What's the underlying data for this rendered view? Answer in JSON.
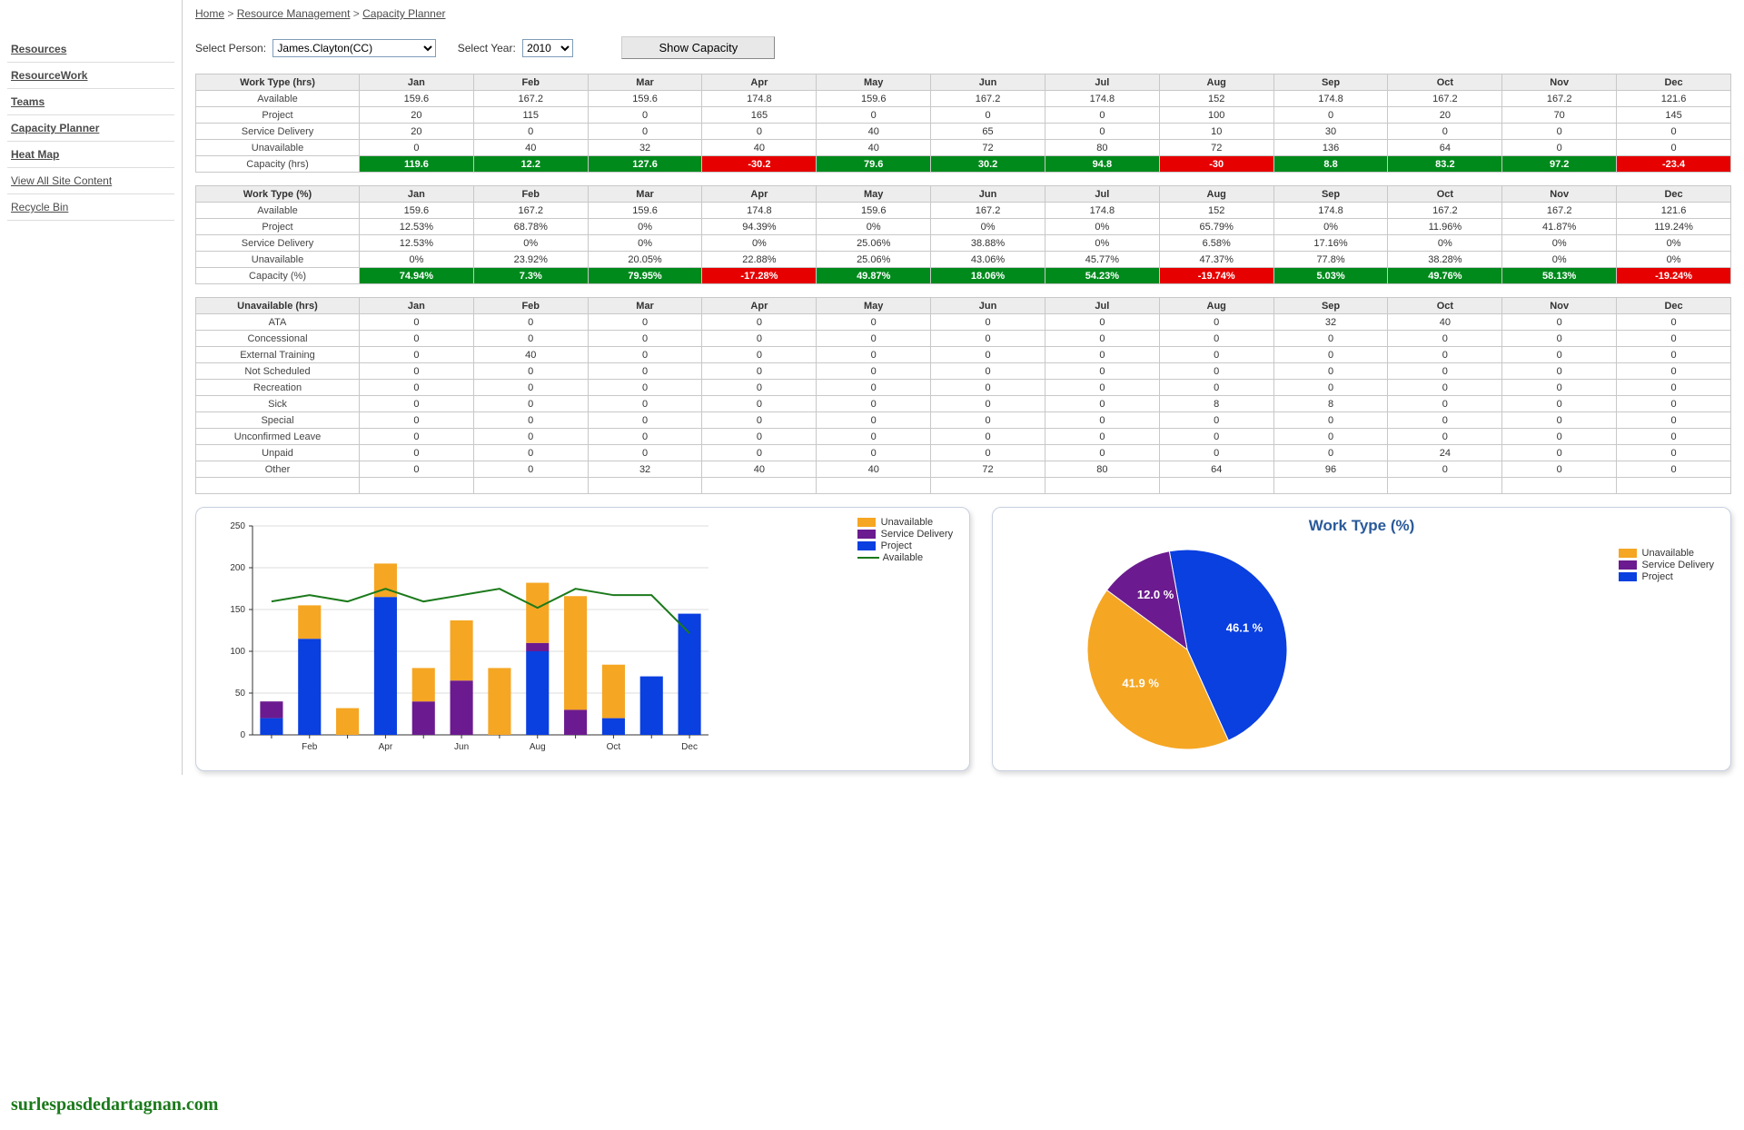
{
  "breadcrumb": {
    "home": "Home",
    "rm": "Resource Management",
    "cp": "Capacity Planner",
    "sep": " > "
  },
  "sidebar": {
    "items": [
      {
        "label": "Resources",
        "bold": true
      },
      {
        "label": "ResourceWork",
        "bold": true
      },
      {
        "label": "Teams",
        "bold": true
      },
      {
        "label": "Capacity Planner",
        "bold": true
      },
      {
        "label": "Heat Map",
        "bold": true
      },
      {
        "label": "View All Site Content",
        "bold": false
      },
      {
        "label": " Recycle Bin",
        "bold": false
      }
    ]
  },
  "controls": {
    "personLabel": "Select Person:",
    "personValue": "James.Clayton(CC)",
    "yearLabel": "Select Year:",
    "yearValue": "2010",
    "button": "Show Capacity"
  },
  "months": [
    "Jan",
    "Feb",
    "Mar",
    "Apr",
    "May",
    "Jun",
    "Jul",
    "Aug",
    "Sep",
    "Oct",
    "Nov",
    "Dec"
  ],
  "table1": {
    "header": "Work Type (hrs)",
    "rows": [
      {
        "label": "Available",
        "vals": [
          "159.6",
          "167.2",
          "159.6",
          "174.8",
          "159.6",
          "167.2",
          "174.8",
          "152",
          "174.8",
          "167.2",
          "167.2",
          "121.6"
        ]
      },
      {
        "label": "Project",
        "vals": [
          "20",
          "115",
          "0",
          "165",
          "0",
          "0",
          "0",
          "100",
          "0",
          "20",
          "70",
          "145"
        ]
      },
      {
        "label": "Service Delivery",
        "vals": [
          "20",
          "0",
          "0",
          "0",
          "40",
          "65",
          "0",
          "10",
          "30",
          "0",
          "0",
          "0"
        ]
      },
      {
        "label": "Unavailable",
        "vals": [
          "0",
          "40",
          "32",
          "40",
          "40",
          "72",
          "80",
          "72",
          "136",
          "64",
          "0",
          "0"
        ]
      },
      {
        "label": "Capacity (hrs)",
        "vals": [
          "119.6",
          "12.2",
          "127.6",
          "-30.2",
          "79.6",
          "30.2",
          "94.8",
          "-30",
          "8.8",
          "83.2",
          "97.2",
          "-23.4"
        ],
        "cls": [
          "green",
          "green",
          "green",
          "red",
          "green",
          "green",
          "green",
          "red",
          "green",
          "green",
          "green",
          "red"
        ]
      }
    ]
  },
  "table2": {
    "header": "Work Type (%)",
    "rows": [
      {
        "label": "Available",
        "vals": [
          "159.6",
          "167.2",
          "159.6",
          "174.8",
          "159.6",
          "167.2",
          "174.8",
          "152",
          "174.8",
          "167.2",
          "167.2",
          "121.6"
        ]
      },
      {
        "label": "Project",
        "vals": [
          "12.53%",
          "68.78%",
          "0%",
          "94.39%",
          "0%",
          "0%",
          "0%",
          "65.79%",
          "0%",
          "11.96%",
          "41.87%",
          "119.24%"
        ]
      },
      {
        "label": "Service Delivery",
        "vals": [
          "12.53%",
          "0%",
          "0%",
          "0%",
          "25.06%",
          "38.88%",
          "0%",
          "6.58%",
          "17.16%",
          "0%",
          "0%",
          "0%"
        ]
      },
      {
        "label": "Unavailable",
        "vals": [
          "0%",
          "23.92%",
          "20.05%",
          "22.88%",
          "25.06%",
          "43.06%",
          "45.77%",
          "47.37%",
          "77.8%",
          "38.28%",
          "0%",
          "0%"
        ]
      },
      {
        "label": "Capacity (%)",
        "vals": [
          "74.94%",
          "7.3%",
          "79.95%",
          "-17.28%",
          "49.87%",
          "18.06%",
          "54.23%",
          "-19.74%",
          "5.03%",
          "49.76%",
          "58.13%",
          "-19.24%"
        ],
        "cls": [
          "green",
          "green",
          "green",
          "red",
          "green",
          "green",
          "green",
          "red",
          "green",
          "green",
          "green",
          "red"
        ]
      }
    ]
  },
  "table3": {
    "header": "Unavailable (hrs)",
    "rows": [
      {
        "label": "ATA",
        "vals": [
          "0",
          "0",
          "0",
          "0",
          "0",
          "0",
          "0",
          "0",
          "32",
          "40",
          "0",
          "0"
        ]
      },
      {
        "label": "Concessional",
        "vals": [
          "0",
          "0",
          "0",
          "0",
          "0",
          "0",
          "0",
          "0",
          "0",
          "0",
          "0",
          "0"
        ]
      },
      {
        "label": "External Training",
        "vals": [
          "0",
          "40",
          "0",
          "0",
          "0",
          "0",
          "0",
          "0",
          "0",
          "0",
          "0",
          "0"
        ]
      },
      {
        "label": "Not Scheduled",
        "vals": [
          "0",
          "0",
          "0",
          "0",
          "0",
          "0",
          "0",
          "0",
          "0",
          "0",
          "0",
          "0"
        ]
      },
      {
        "label": "Recreation",
        "vals": [
          "0",
          "0",
          "0",
          "0",
          "0",
          "0",
          "0",
          "0",
          "0",
          "0",
          "0",
          "0"
        ]
      },
      {
        "label": "Sick",
        "vals": [
          "0",
          "0",
          "0",
          "0",
          "0",
          "0",
          "0",
          "8",
          "8",
          "0",
          "0",
          "0"
        ]
      },
      {
        "label": "Special",
        "vals": [
          "0",
          "0",
          "0",
          "0",
          "0",
          "0",
          "0",
          "0",
          "0",
          "0",
          "0",
          "0"
        ]
      },
      {
        "label": "Unconfirmed Leave",
        "vals": [
          "0",
          "0",
          "0",
          "0",
          "0",
          "0",
          "0",
          "0",
          "0",
          "0",
          "0",
          "0"
        ]
      },
      {
        "label": "Unpaid",
        "vals": [
          "0",
          "0",
          "0",
          "0",
          "0",
          "0",
          "0",
          "0",
          "0",
          "24",
          "0",
          "0"
        ]
      },
      {
        "label": "Other",
        "vals": [
          "0",
          "0",
          "32",
          "40",
          "40",
          "72",
          "80",
          "64",
          "96",
          "0",
          "0",
          "0"
        ]
      }
    ],
    "blankRow": true
  },
  "colors": {
    "unavailable": "#f5a623",
    "service": "#6b1b8f",
    "project": "#0a3fe0",
    "available": "#1b7a1b"
  },
  "chart_data": [
    {
      "type": "bar",
      "title": "",
      "ylabel": "",
      "xlabel": "",
      "ylim": [
        0,
        250
      ],
      "yticks": [
        0,
        50,
        100,
        150,
        200,
        250
      ],
      "categories": [
        "Jan",
        "Feb",
        "Mar",
        "Apr",
        "May",
        "Jun",
        "Jul",
        "Aug",
        "Sep",
        "Oct",
        "Nov",
        "Dec"
      ],
      "xTickLabels": [
        "Feb",
        "Apr",
        "Jun",
        "Aug",
        "Oct",
        "Dec"
      ],
      "series": [
        {
          "name": "Project",
          "color": "#0a3fe0",
          "values": [
            20,
            115,
            0,
            165,
            0,
            0,
            0,
            100,
            0,
            20,
            70,
            145
          ]
        },
        {
          "name": "Service Delivery",
          "color": "#6b1b8f",
          "values": [
            20,
            0,
            0,
            0,
            40,
            65,
            0,
            10,
            30,
            0,
            0,
            0
          ]
        },
        {
          "name": "Unavailable",
          "color": "#f5a623",
          "values": [
            0,
            40,
            32,
            40,
            40,
            72,
            80,
            72,
            136,
            64,
            0,
            0
          ]
        }
      ],
      "line": {
        "name": "Available",
        "color": "#1b7a1b",
        "values": [
          159.6,
          167.2,
          159.6,
          174.8,
          159.6,
          167.2,
          174.8,
          152,
          174.8,
          167.2,
          167.2,
          121.6
        ]
      },
      "legend": [
        "Unavailable",
        "Service Delivery",
        "Project",
        "Available"
      ]
    },
    {
      "type": "pie",
      "title": "Work Type (%)",
      "slices": [
        {
          "name": "Project",
          "value": 46.1,
          "label": "46.1 %",
          "color": "#0a3fe0"
        },
        {
          "name": "Unavailable",
          "value": 41.9,
          "label": "41.9 %",
          "color": "#f5a623"
        },
        {
          "name": "Service Delivery",
          "value": 12.0,
          "label": "12.0 %",
          "color": "#6b1b8f"
        }
      ],
      "legend": [
        "Unavailable",
        "Service Delivery",
        "Project"
      ]
    }
  ],
  "watermark": "surlespasdedartagnan.com"
}
